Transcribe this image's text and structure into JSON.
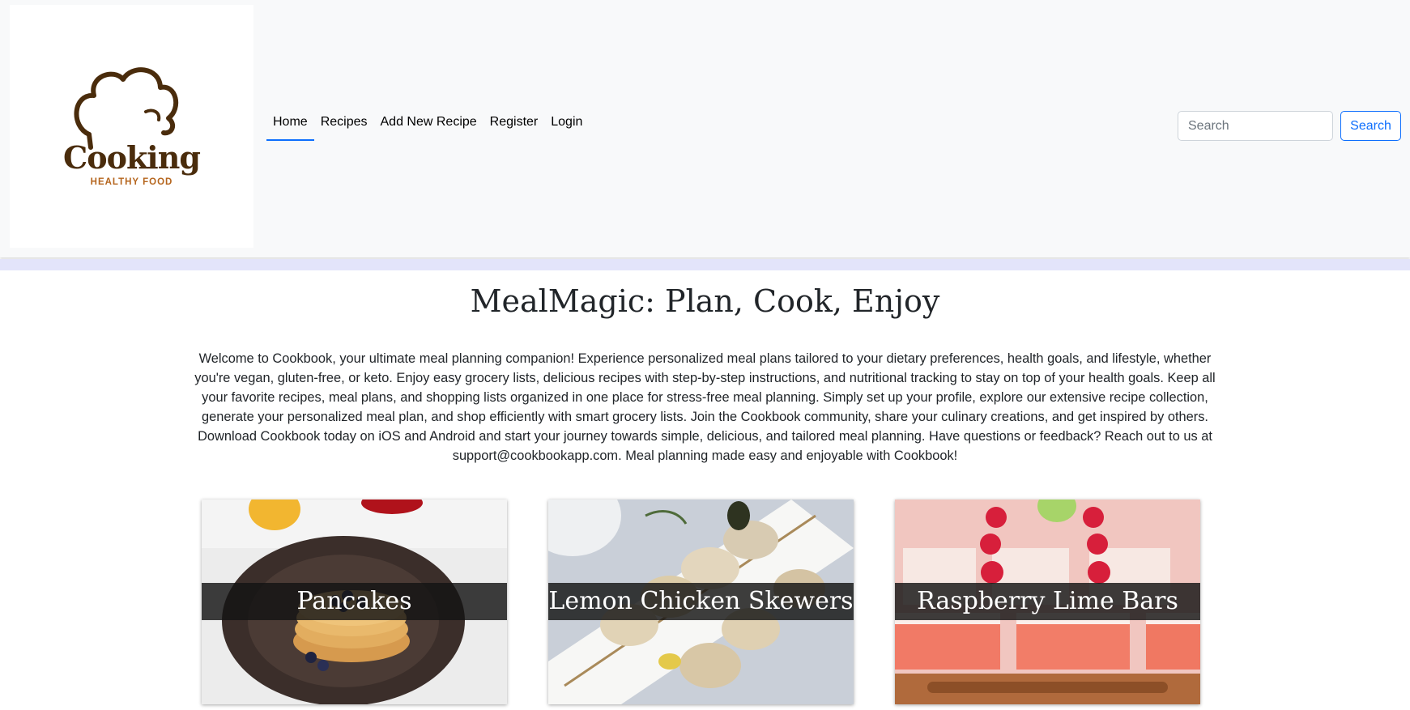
{
  "brand": {
    "logo_word": "Cooking",
    "logo_subtitle": "HEALTHY FOOD",
    "logo_color": "#4a2c0c",
    "logo_accent": "#b5651d"
  },
  "nav": {
    "items": [
      {
        "label": "Home",
        "active": true
      },
      {
        "label": "Recipes"
      },
      {
        "label": "Add New Recipe"
      },
      {
        "label": "Register"
      },
      {
        "label": "Login"
      }
    ]
  },
  "search": {
    "placeholder": "Search",
    "button_label": "Search"
  },
  "main": {
    "title": "MealMagic: Plan, Cook, Enjoy",
    "intro": "Welcome to Cookbook, your ultimate meal planning companion! Experience personalized meal plans tailored to your dietary preferences, health goals, and lifestyle, whether you're vegan, gluten-free, or keto. Enjoy easy grocery lists, delicious recipes with step-by-step instructions, and nutritional tracking to stay on top of your health goals. Keep all your favorite recipes, meal plans, and shopping lists organized in one place for stress-free meal planning. Simply set up your profile, explore our extensive recipe collection, generate your personalized meal plan, and shop efficiently with smart grocery lists. Join the Cookbook community, share your culinary creations, and get inspired by others. Download Cookbook today on iOS and Android and start your journey towards simple, delicious, and tailored meal planning. Have questions or feedback? Reach out to us at support@cookbookapp.com. Meal planning made easy and enjoyable with Cookbook!"
  },
  "cards": [
    {
      "title": "Pancakes"
    },
    {
      "title": "Lemon Chicken Skewers"
    },
    {
      "title": "Raspberry Lime Bars"
    }
  ],
  "colors": {
    "accent": "#0d6efd",
    "navbar_bg": "#f8f9fa",
    "strip": "#e3e4fa"
  }
}
